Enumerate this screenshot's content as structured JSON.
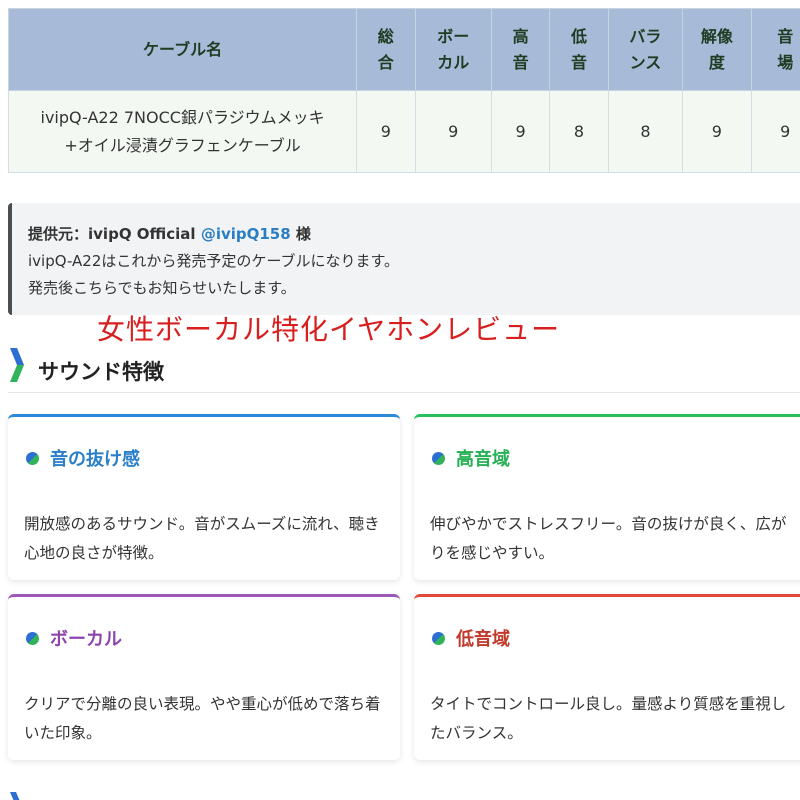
{
  "table": {
    "headers": [
      "ケーブル名",
      "総合",
      "ボーカル",
      "高音",
      "低音",
      "バランス",
      "解像度",
      "音場"
    ],
    "rows": [
      {
        "name_line1": "ivipQ-A22 7NOCC銀パラジウムメッキ",
        "name_line2": "+オイル浸漬グラフェンケーブル",
        "scores": [
          "9",
          "9",
          "9",
          "8",
          "8",
          "9",
          "9"
        ]
      }
    ]
  },
  "provider": {
    "label": "提供元：",
    "name": "ivipQ Official",
    "handle": "@ivipQ158",
    "honorific": "様",
    "line2": "ivipQ-A22はこれから発売予定のケーブルになります。",
    "line3": "発売後こちらでもお知らせいたします。"
  },
  "watermark": "女性ボーカル特化イヤホンレビュー",
  "section": {
    "title": "サウンド特徴"
  },
  "cards": [
    {
      "title": "音の抜け感",
      "text": "開放感のあるサウンド。音がスムーズに流れ、聴き心地の良さが特徴。",
      "accent": "#2c88d8"
    },
    {
      "title": "高音域",
      "text": "伸びやかでストレスフリー。音の抜けが良く、広がりを感じやすい。",
      "accent": "#27c05c"
    },
    {
      "title": "ボーカル",
      "text": "クリアで分離の良い表現。やや重心が低めで落ち着いた印象。",
      "accent": "#9b59b6"
    },
    {
      "title": "低音域",
      "text": "タイトでコントロール良し。量感より質感を重視したバランス。",
      "accent": "#e04a3a"
    }
  ],
  "colors": {
    "table_header_bg": "#a7bad7",
    "table_header_text": "#1f3b22",
    "row_bg": "#f3f8f3",
    "watermark": "#d81e1e",
    "link": "#2a7ec1"
  }
}
